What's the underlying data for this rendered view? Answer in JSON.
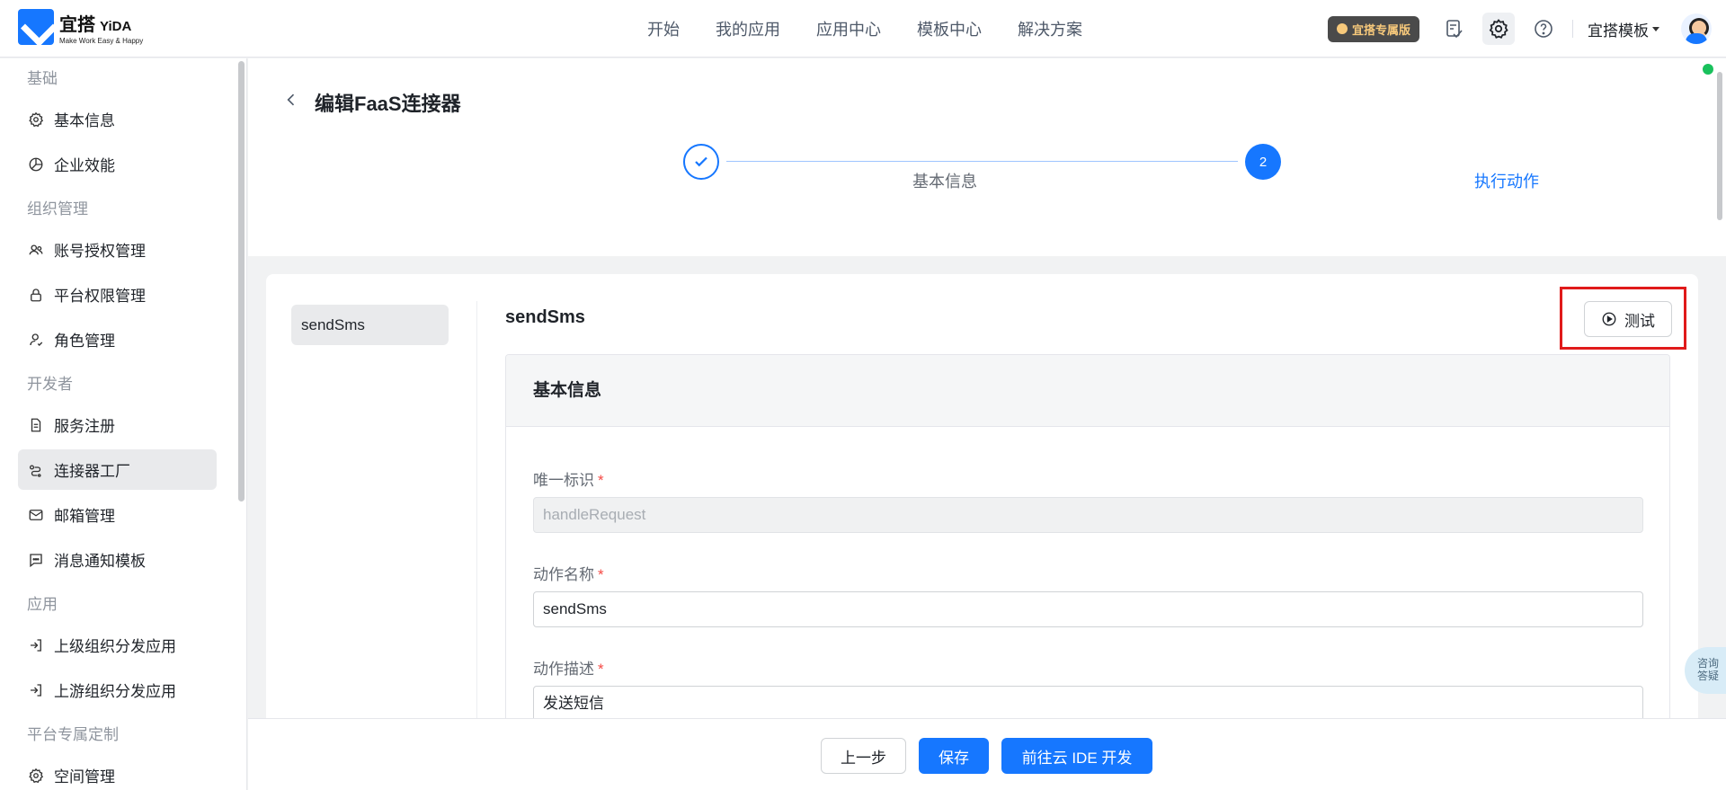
{
  "header": {
    "logo_cn": "宜搭",
    "logo_en": "YiDA",
    "logo_slogan": "Make Work Easy & Happy",
    "nav": [
      "开始",
      "我的应用",
      "应用中心",
      "模板中心",
      "解决方案"
    ],
    "vip_badge": "宜搭专属版",
    "template_menu": "宜搭模板"
  },
  "sidebar": {
    "groups": [
      {
        "title": "基础",
        "items": [
          {
            "label": "基本信息",
            "icon": "gear-icon"
          },
          {
            "label": "企业效能",
            "icon": "pie-chart-icon"
          }
        ]
      },
      {
        "title": "组织管理",
        "items": [
          {
            "label": "账号授权管理",
            "icon": "users-icon"
          },
          {
            "label": "平台权限管理",
            "icon": "lock-icon"
          },
          {
            "label": "角色管理",
            "icon": "user-role-icon"
          }
        ]
      },
      {
        "title": "开发者",
        "items": [
          {
            "label": "服务注册",
            "icon": "document-icon"
          },
          {
            "label": "连接器工厂",
            "icon": "connector-icon",
            "active": true
          },
          {
            "label": "邮箱管理",
            "icon": "mail-icon"
          },
          {
            "label": "消息通知模板",
            "icon": "message-icon"
          }
        ]
      },
      {
        "title": "应用",
        "items": [
          {
            "label": "上级组织分发应用",
            "icon": "import-icon"
          },
          {
            "label": "上游组织分发应用",
            "icon": "import-icon"
          }
        ]
      },
      {
        "title": "平台专属定制",
        "items": [
          {
            "label": "空间管理",
            "icon": "gear-icon"
          }
        ]
      }
    ]
  },
  "page": {
    "title": "编辑FaaS连接器",
    "steps": [
      {
        "number": "1",
        "label": "基本信息",
        "status": "done"
      },
      {
        "number": "2",
        "label": "执行动作",
        "status": "current"
      }
    ]
  },
  "action": {
    "tab_label": "sendSms",
    "title": "sendSms",
    "test_label": "测试",
    "section_title": "基本信息",
    "fields": [
      {
        "label": "唯一标识",
        "value": "handleRequest",
        "required": true,
        "disabled": true
      },
      {
        "label": "动作名称",
        "value": "sendSms",
        "required": true,
        "disabled": false
      },
      {
        "label": "动作描述",
        "value": "发送短信",
        "required": true,
        "disabled": false
      }
    ]
  },
  "footer": {
    "prev": "上一步",
    "save": "保存",
    "ide": "前往云 IDE 开发"
  },
  "float_widget": {
    "line1": "咨询",
    "line2": "答疑"
  },
  "colors": {
    "primary": "#1677ff",
    "highlight_border": "#e01a1a",
    "required": "#f54a45",
    "online": "#19c15c"
  }
}
